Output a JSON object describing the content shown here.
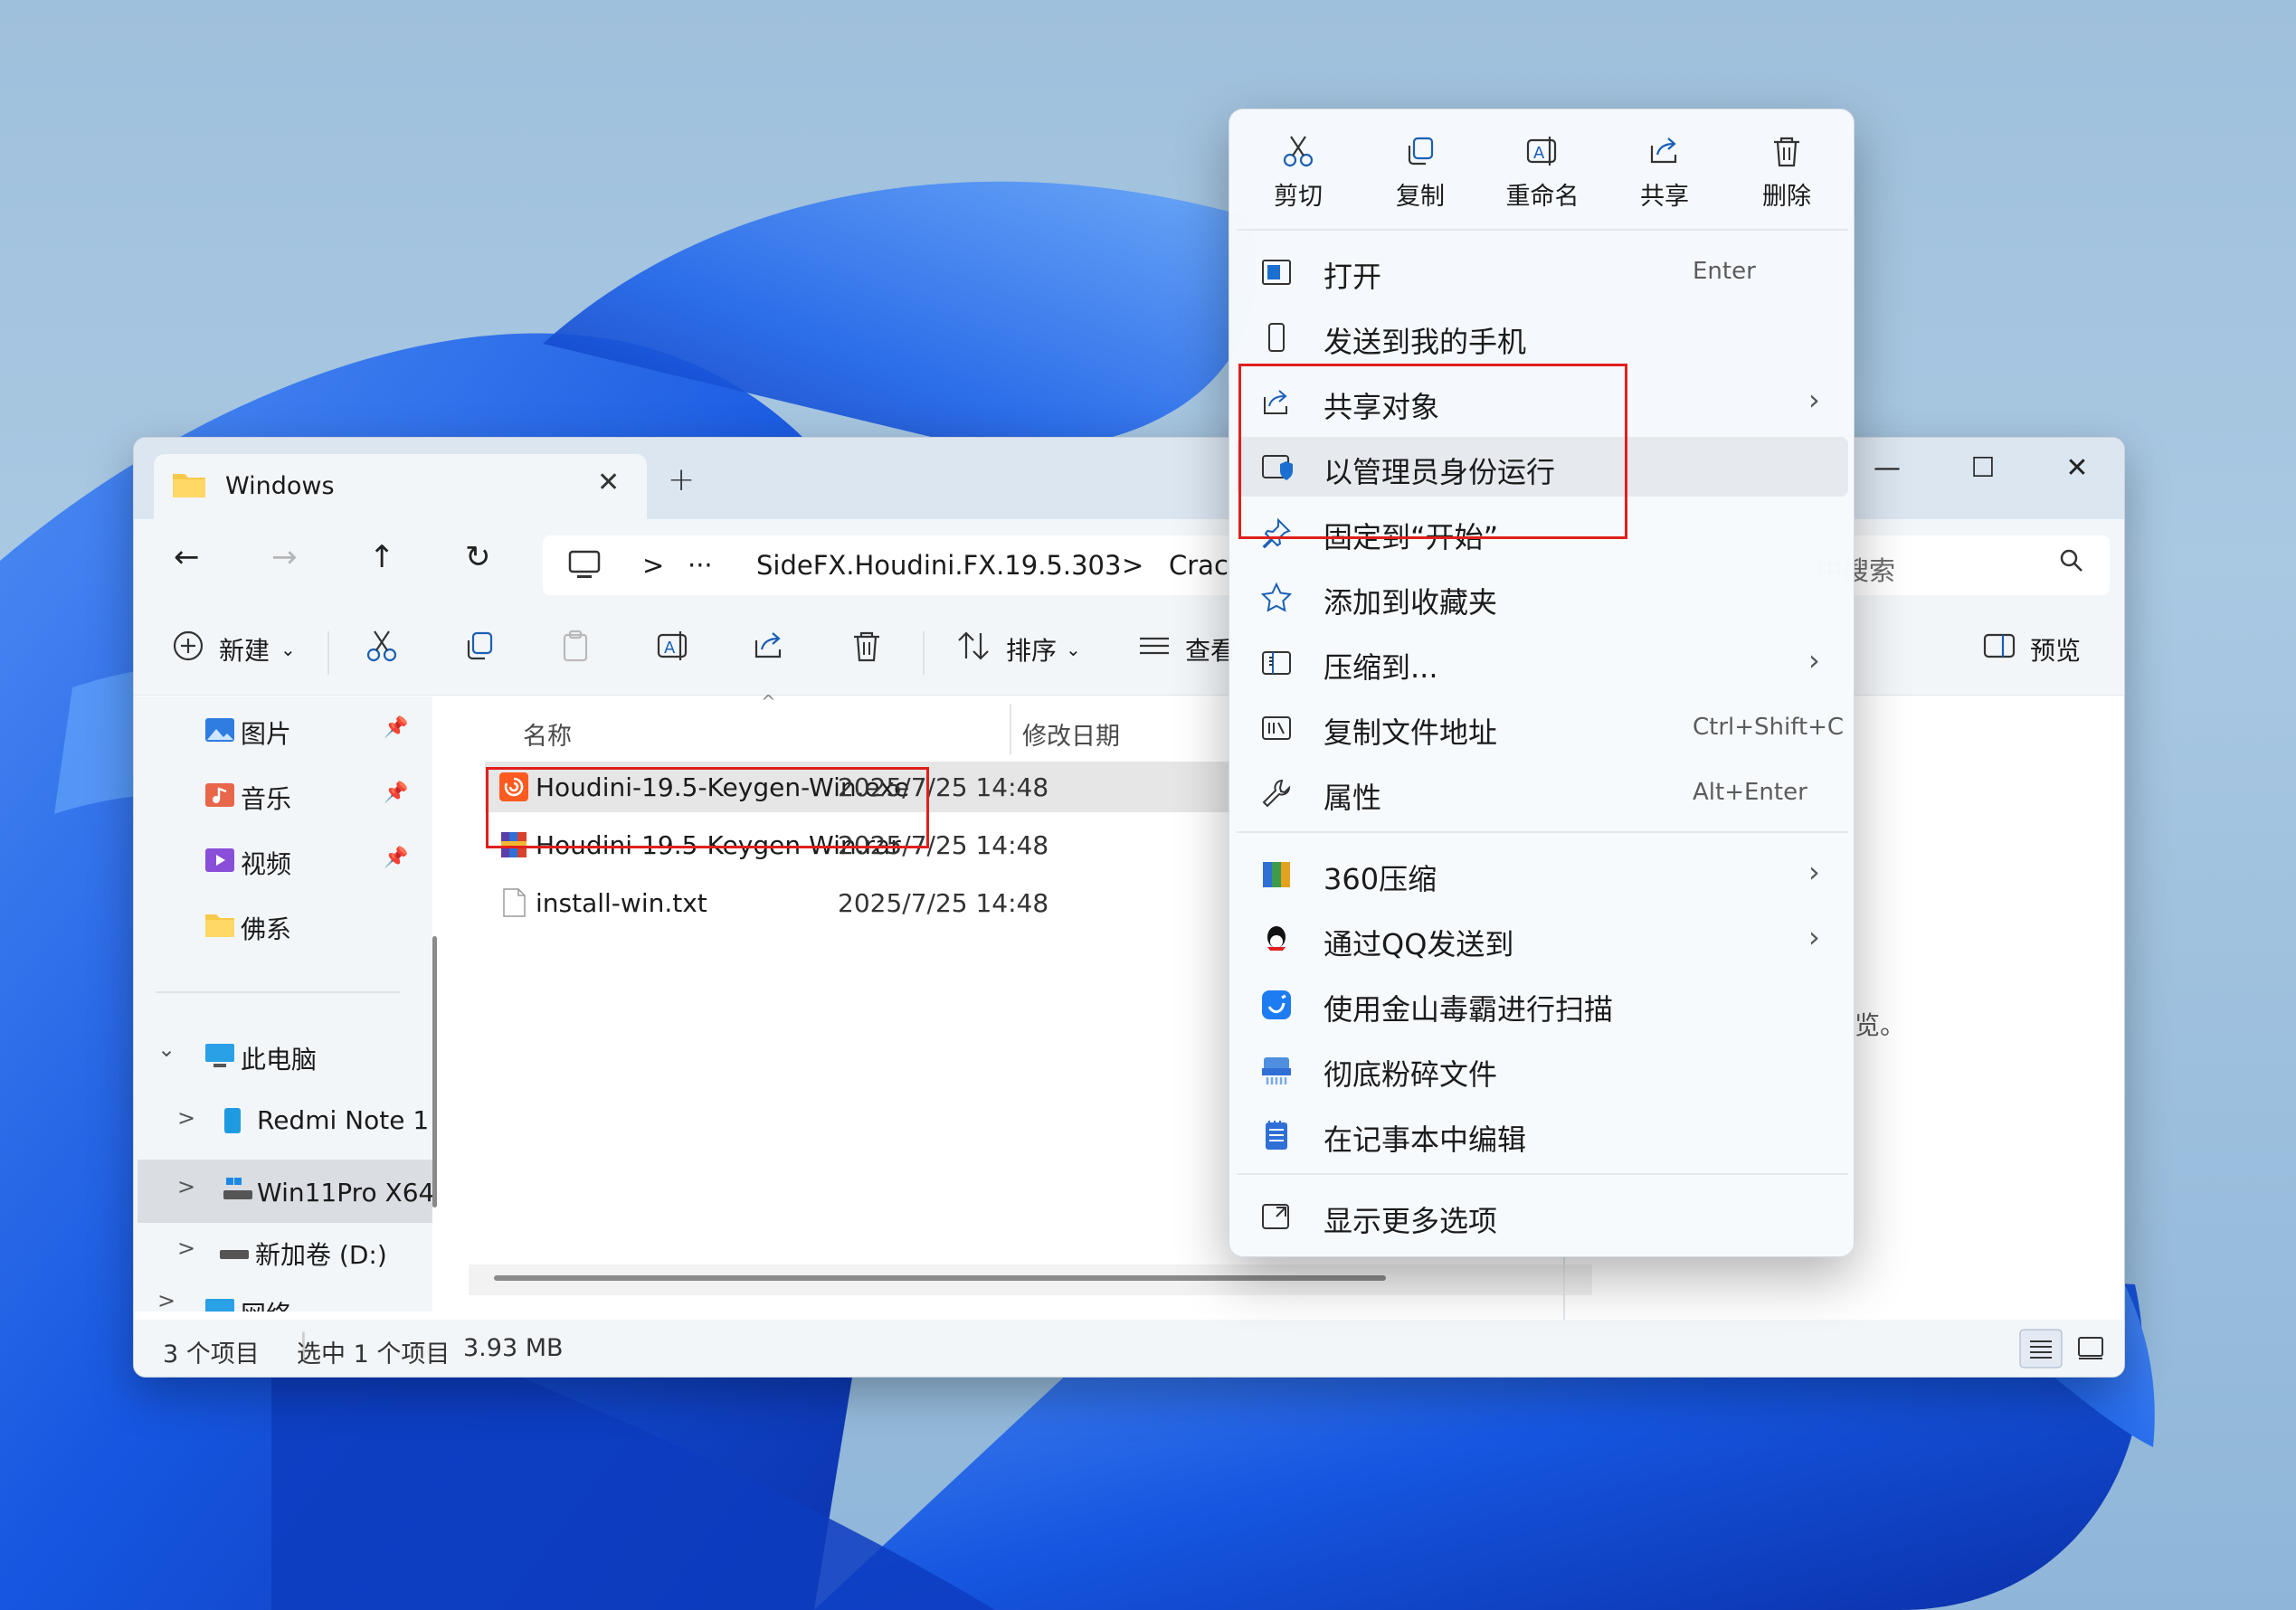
{
  "explorer": {
    "tab_title": "Windows",
    "tab_close": "✕",
    "new_tab": "+",
    "window_controls": {
      "minimize": "—",
      "maximize": "☐",
      "close": "✕"
    },
    "nav": {
      "back": "←",
      "forward": "→",
      "up": "↑",
      "refresh": "↻"
    },
    "address": {
      "more": "···",
      "sep1": ">",
      "path1": "SideFX.Houdini.FX.19.5.303",
      "sep2": ">",
      "path2": "Crac"
    },
    "search_placeholder": "中搜索",
    "toolbar": {
      "new_label": "新建",
      "sort_label": "排序",
      "view_label": "查看",
      "preview_label": "预览"
    },
    "sidebar": {
      "quick": [
        {
          "label": "图片",
          "pin": "📌"
        },
        {
          "label": "音乐",
          "pin": "📌"
        },
        {
          "label": "视频",
          "pin": "📌"
        },
        {
          "label": "佛系"
        }
      ],
      "tree": [
        {
          "label": "此电脑",
          "chevron": "⌄"
        },
        {
          "label": "Redmi Note 1",
          "chevron": ">"
        },
        {
          "label": "Win11Pro X64",
          "chevron": ">"
        },
        {
          "label": "新加卷 (D:)",
          "chevron": ">"
        },
        {
          "label": "网络",
          "chevron": ">"
        }
      ]
    },
    "columns": {
      "name": "名称",
      "modified": "修改日期",
      "sort_arrow": "^"
    },
    "files": [
      {
        "name": "Houdini-19.5-Keygen-Win.exe",
        "date": "2025/7/25 14:48",
        "selected": true,
        "icon": "houdini-exe-icon"
      },
      {
        "name": "Houdini-19.5-Keygen-Win.rar",
        "date": "2025/7/25 14:48",
        "selected": false,
        "icon": "rar-archive-icon"
      },
      {
        "name": "install-win.txt",
        "date": "2025/7/25 14:48",
        "selected": false,
        "icon": "text-file-icon"
      }
    ],
    "preview_hint": "览。",
    "status": {
      "count": "3 个项目",
      "selection": "选中 1 个项目",
      "size": "3.93 MB"
    }
  },
  "context_menu": {
    "quick_actions": [
      {
        "label": "剪切",
        "icon": "cut-icon"
      },
      {
        "label": "复制",
        "icon": "copy-icon"
      },
      {
        "label": "重命名",
        "icon": "rename-icon"
      },
      {
        "label": "共享",
        "icon": "share-icon"
      },
      {
        "label": "删除",
        "icon": "delete-icon"
      }
    ],
    "items": [
      {
        "label": "打开",
        "shortcut": "Enter",
        "icon": "open-icon"
      },
      {
        "label": "发送到我的手机",
        "icon": "phone-icon"
      },
      {
        "label": "共享对象",
        "submenu": "›",
        "icon": "share-icon"
      },
      {
        "label": "以管理员身份运行",
        "icon": "admin-shield-icon",
        "hover": true
      },
      {
        "label": "固定到“开始”",
        "icon": "pin-icon"
      },
      {
        "label": "添加到收藏夹",
        "icon": "star-icon"
      },
      {
        "label": "压缩到...",
        "submenu": "›",
        "icon": "compress-icon"
      },
      {
        "label": "复制文件地址",
        "shortcut": "Ctrl+Shift+C",
        "icon": "copy-path-icon"
      },
      {
        "label": "属性",
        "shortcut": "Alt+Enter",
        "icon": "wrench-icon"
      }
    ],
    "third_party": [
      {
        "label": "360压缩",
        "submenu": "›",
        "icon": "360-zip-icon"
      },
      {
        "label": "通过QQ发送到",
        "submenu": "›",
        "icon": "qq-icon"
      },
      {
        "label": "使用金山毒霸进行扫描",
        "icon": "kingsoft-icon"
      },
      {
        "label": "彻底粉碎文件",
        "icon": "shredder-icon"
      },
      {
        "label": "在记事本中编辑",
        "icon": "notepad-icon"
      }
    ],
    "more_options": {
      "label": "显示更多选项",
      "icon": "more-options-icon"
    }
  },
  "colors": {
    "accent": "#0067c0",
    "highlight_box": "#e0201b",
    "wallpaper_blue": "#1d5ce0"
  }
}
